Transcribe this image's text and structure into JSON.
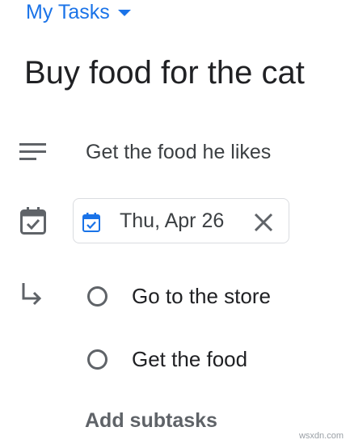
{
  "list_selector": {
    "label": "My Tasks",
    "icon": "caret-down-icon",
    "color": "#1a73e8"
  },
  "task": {
    "title": "Buy food for the cat"
  },
  "details": {
    "icon": "notes-icon",
    "text": "Get the food he likes"
  },
  "due_date": {
    "icon": "calendar-icon",
    "chip_icon": "calendar-small-icon",
    "value": "Thu, Apr 26",
    "clear_icon": "close-icon"
  },
  "subtasks": {
    "icon": "subtask-arrow-icon",
    "items": [
      {
        "label": "Go to the store",
        "completed": false
      },
      {
        "label": "Get the food",
        "completed": false
      }
    ],
    "add_label": "Add subtasks"
  },
  "watermark": "wsxdn.com"
}
